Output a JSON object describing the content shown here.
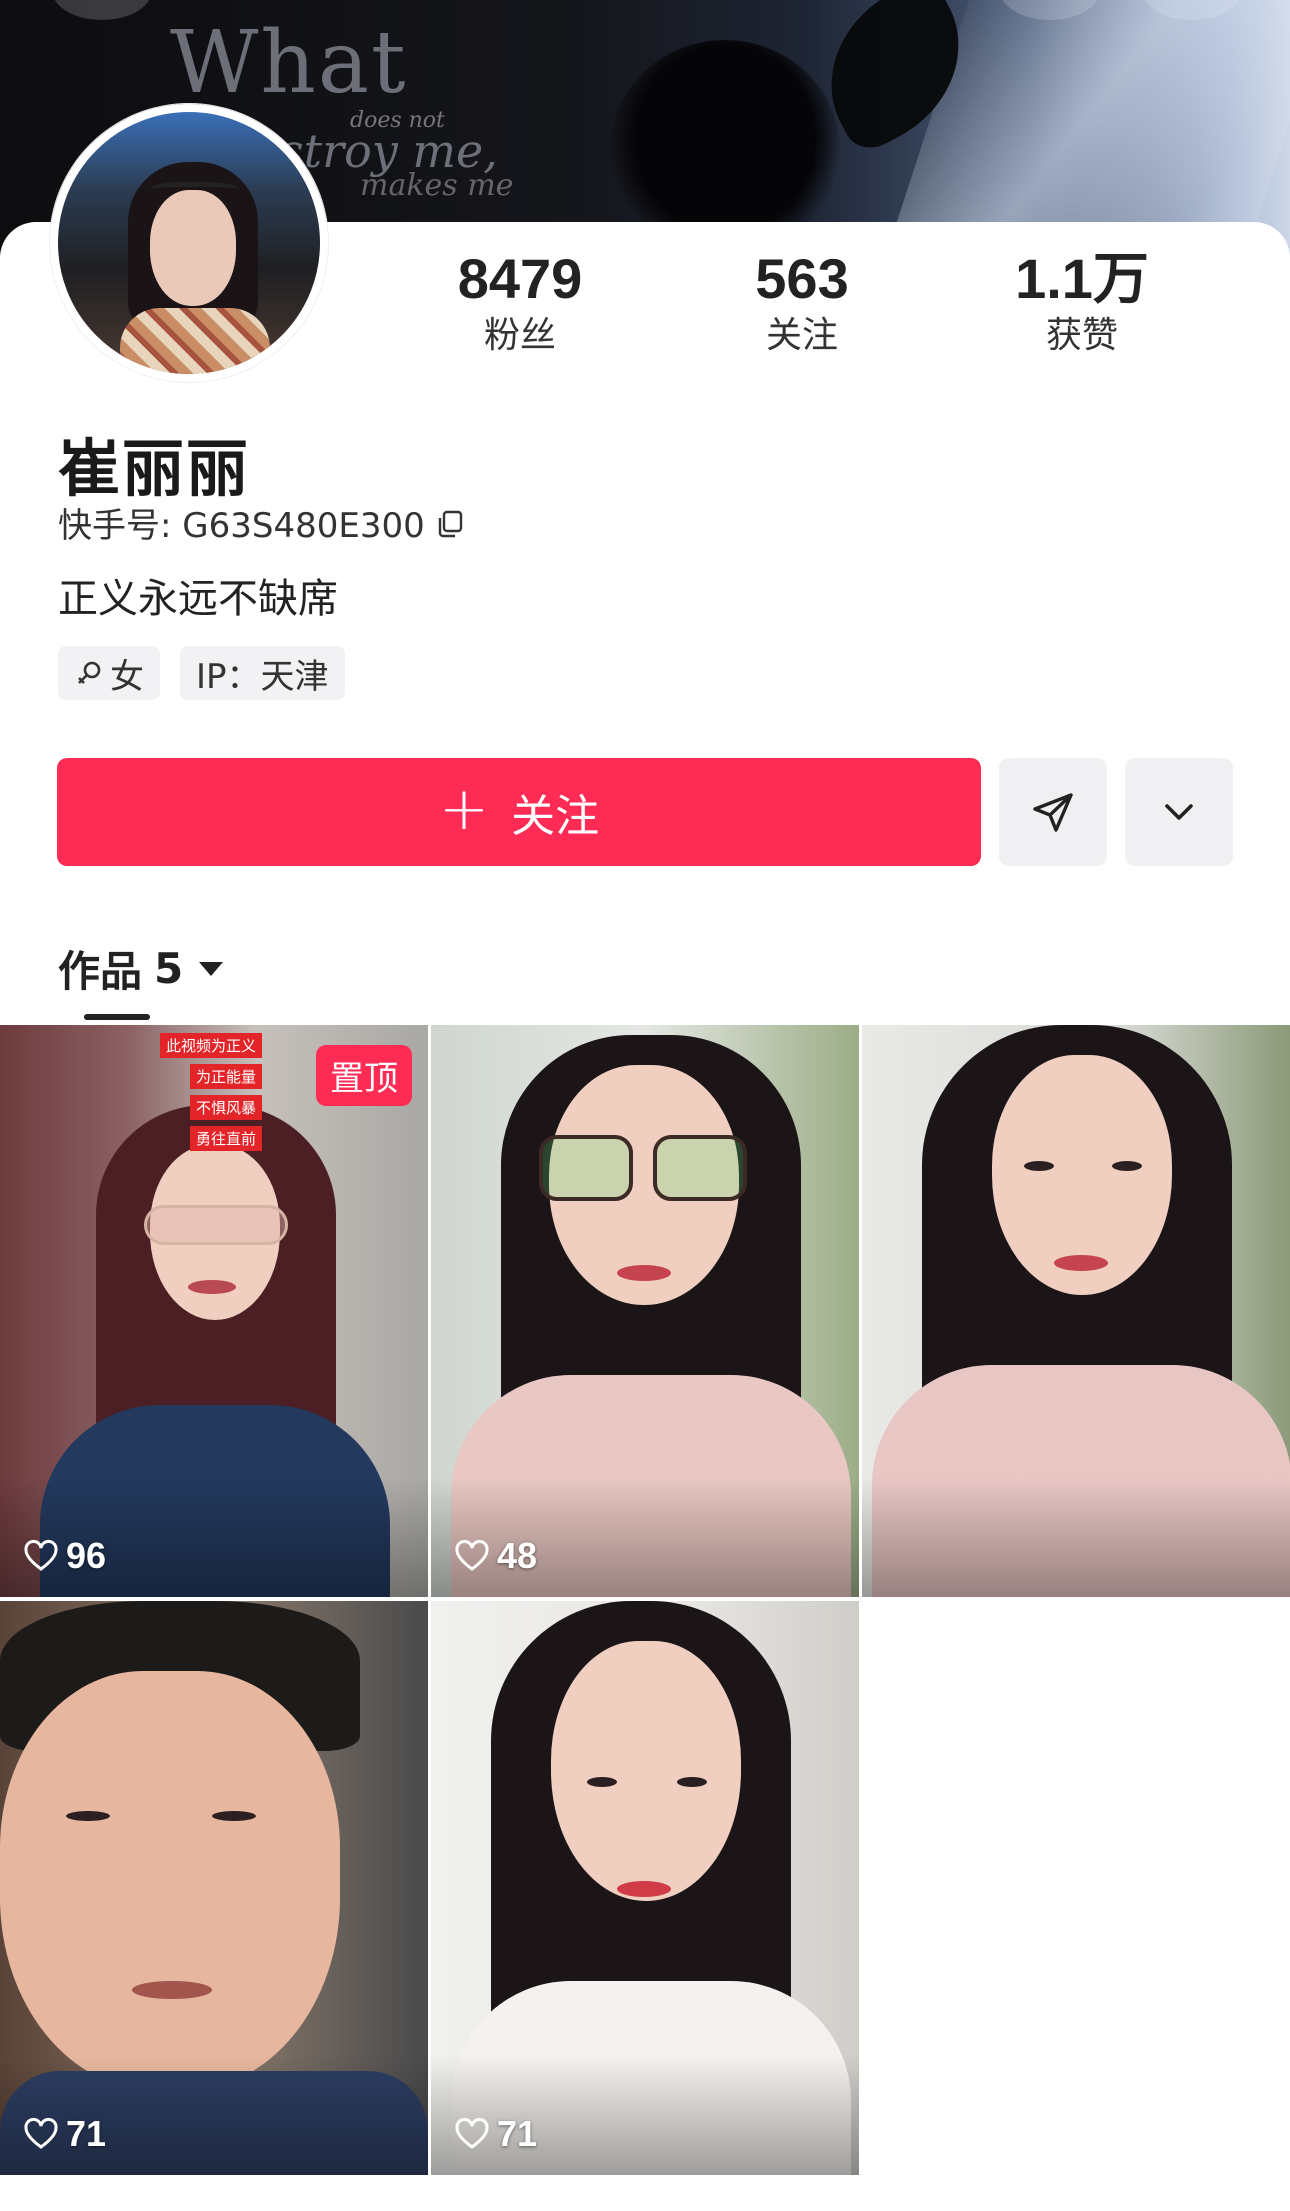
{
  "cover": {
    "quote_big": "What",
    "quote_small": "does not",
    "quote_line2": "stroy me,",
    "quote_line3": "makes me"
  },
  "profile": {
    "name": "崔丽丽",
    "uid_label": "快手号: G63S480E300",
    "bio": "正义永远不缺席",
    "tags": [
      {
        "icon": "female-icon",
        "label": "女"
      },
      {
        "label": "IP：天津"
      }
    ]
  },
  "stats": [
    {
      "value": "8479",
      "label": "粉丝"
    },
    {
      "value": "563",
      "label": "关注"
    },
    {
      "value": "1.1万",
      "label": "获赞"
    }
  ],
  "actions": {
    "follow_label": "关注",
    "follow_color": "#fe2c55",
    "share_icon": "send-icon",
    "more_icon": "chevron-down-icon"
  },
  "works": {
    "tab_label": "作品",
    "count": "5"
  },
  "videos": [
    {
      "likes": "96",
      "pinned_label": "置顶",
      "captions": [
        "此视频为正义",
        "为正能量",
        "不惧风暴",
        "勇往直前"
      ]
    },
    {
      "likes": "48"
    },
    {
      "likes": ""
    },
    {
      "likes": "71"
    },
    {
      "likes": "71"
    }
  ]
}
